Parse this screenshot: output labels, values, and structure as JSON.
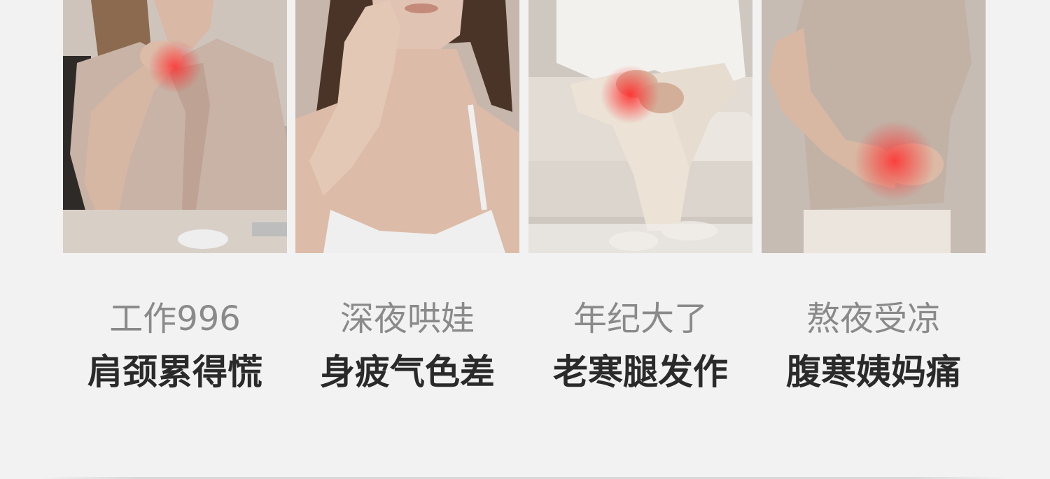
{
  "cards": [
    {
      "image_label": "woman-holding-neck-photo",
      "line1": "工作996",
      "line2": "肩颈累得慌"
    },
    {
      "image_label": "woman-touching-face-photo",
      "line1": "深夜哄娃",
      "line2": "身疲气色差"
    },
    {
      "image_label": "person-holding-knee-photo",
      "line1": "年纪大了",
      "line2": "老寒腿发作"
    },
    {
      "image_label": "woman-holding-abdomen-photo",
      "line1": "熬夜受凉",
      "line2": "腹寒姨妈痛"
    }
  ],
  "colors": {
    "background": "#f2f2f2",
    "caption_top": "#8a8a8a",
    "caption_bottom": "#2a2a2a",
    "pain_highlight": "#ff3b3b"
  }
}
